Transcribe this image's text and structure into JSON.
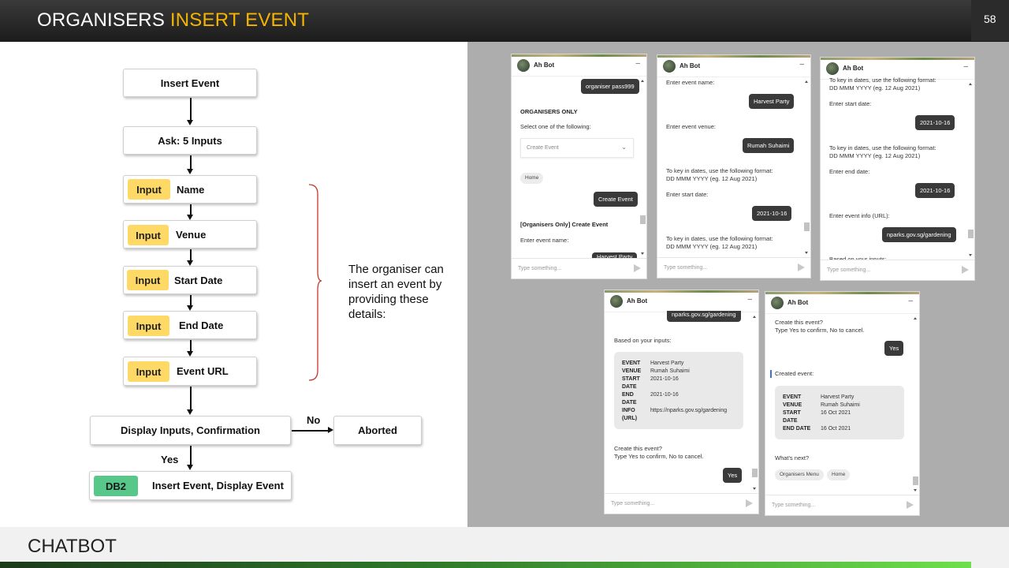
{
  "header": {
    "title_white": "ORGANISERS",
    "title_accent": "INSERT EVENT"
  },
  "footer": {
    "section": "CHATBOT",
    "page_number": "58"
  },
  "flowchart": {
    "start": "Insert Event",
    "ask": "Ask: 5 Inputs",
    "inputs": [
      {
        "badge": "Input",
        "label": "Name"
      },
      {
        "badge": "Input",
        "label": "Venue"
      },
      {
        "badge": "Input",
        "label": "Start Date"
      },
      {
        "badge": "Input",
        "label": "End Date"
      },
      {
        "badge": "Input",
        "label": "Event URL"
      }
    ],
    "display": "Display Inputs, Confirmation",
    "no_label": "No",
    "aborted": "Aborted",
    "yes_label": "Yes",
    "final_badge": "DB2",
    "final_label": "Insert Event, Display Event",
    "note": "The organiser can insert an event by providing these details:"
  },
  "chat_common": {
    "bot_name": "Ah Bot",
    "minimize": "–",
    "placeholder": "Type something..."
  },
  "chat1": {
    "user_pass": "organiser pass999",
    "heading": "ORGANISERS ONLY",
    "prompt": "Select one of the following:",
    "dropdown_value": "Create Event",
    "chip_home": "Home",
    "user_create": "Create Event",
    "sub_heading": "[Organisers Only] Create Event",
    "ask_name": "Enter event name:",
    "partial": "Harvest Party"
  },
  "chat2": {
    "ask_name": "Enter event name:",
    "user_name": "Harvest Party",
    "ask_venue": "Enter event venue:",
    "user_venue": "Rumah Suhaimi",
    "date_hint_1": "To key in dates, use the following format:",
    "date_hint_2": "DD MMM YYYY (eg. 12 Aug 2021)",
    "ask_start": "Enter start date:",
    "user_start": "2021-10-16",
    "date_hint2_1": "To key in dates, use the following format:",
    "date_hint2_2": "DD MMM YYYY (eg. 12 Aug 2021)"
  },
  "chat3": {
    "date_hint_1": "To key in dates, use the following format:",
    "date_hint_2": "DD MMM YYYY (eg. 12 Aug 2021)",
    "ask_start": "Enter start date:",
    "user_start": "2021-10-16",
    "date_hint2_1": "To key in dates, use the following format:",
    "date_hint2_2": "DD MMM YYYY (eg. 12 Aug 2021)",
    "ask_end": "Enter end date:",
    "user_end": "2021-10-16",
    "ask_info": "Enter event info (URL):",
    "user_info": "nparks.gov.sg/gardening",
    "partial": "Based on your inputs:"
  },
  "chat4": {
    "user_info": "nparks.gov.sg/gardening",
    "based_on": "Based on your inputs:",
    "rows": [
      {
        "k": "EVENT",
        "v": "Harvest Party"
      },
      {
        "k": "VENUE",
        "v": "Rumah Suhaimi"
      },
      {
        "k": "START",
        "v": "2021-10-16"
      },
      {
        "k": "DATE",
        "v": ""
      },
      {
        "k": "END",
        "v": "2021-10-16"
      },
      {
        "k": "DATE",
        "v": ""
      },
      {
        "k": "INFO",
        "v": "https://nparks.gov.sg/gardening"
      },
      {
        "k": "(URL)",
        "v": ""
      }
    ],
    "confirm_1": "Create this event?",
    "confirm_2": "Type Yes to confirm, No to cancel.",
    "user_yes": "Yes"
  },
  "chat5": {
    "confirm_1": "Create this event?",
    "confirm_2": "Type Yes to confirm, No to cancel.",
    "user_yes": "Yes",
    "created": "Created event:",
    "rows": [
      {
        "k": "EVENT",
        "v": "Harvest Party"
      },
      {
        "k": "VENUE",
        "v": "Rumah Suhaimi"
      },
      {
        "k": "START",
        "v": "16 Oct 2021"
      },
      {
        "k": "DATE",
        "v": ""
      },
      {
        "k": "END DATE",
        "v": "16 Oct 2021"
      }
    ],
    "whats_next": "What's next?",
    "chip_menu": "Organisers Menu",
    "chip_home": "Home"
  }
}
